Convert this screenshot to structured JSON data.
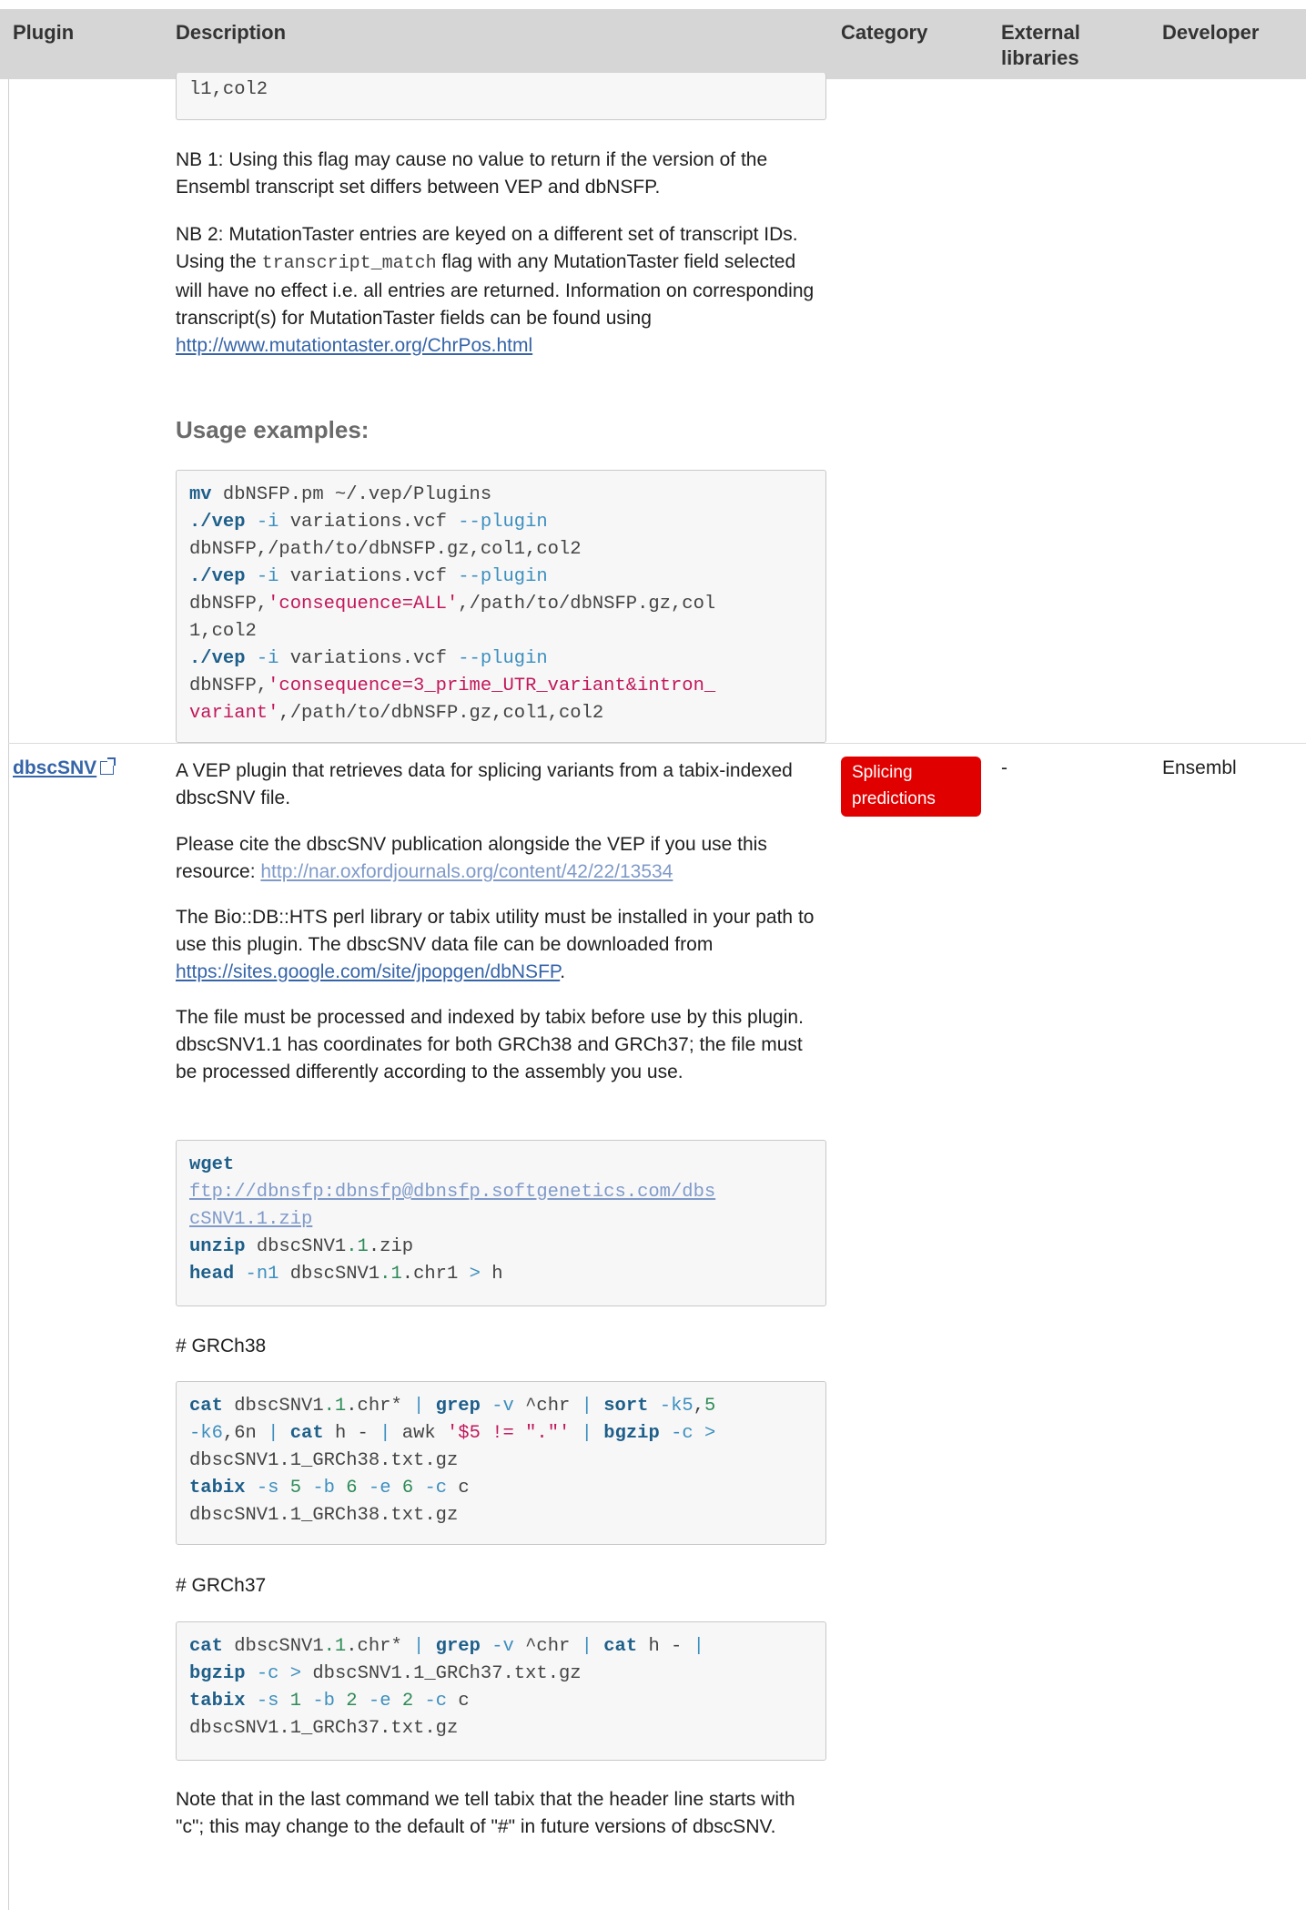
{
  "table_header": {
    "plugin": "Plugin",
    "description": "Description",
    "category": "Category",
    "external_libraries": "External libraries",
    "developer": "Developer"
  },
  "dbnsfp_section": {
    "code_tail": "l1,col2",
    "nb1": "NB 1: Using this flag may cause no value to return if the version of the Ensembl transcript set differs between VEP and dbNSFP.",
    "nb2_a": "NB 2: MutationTaster entries are keyed on a different set of transcript IDs. Using the ",
    "nb2_code": "transcript_match",
    "nb2_b": " flag with any MutationTaster field selected will have no effect i.e. all entries are returned. Information on corresponding transcript(s) for MutationTaster fields can be found using ",
    "nb2_link": "http://www.mutationtaster.org/ChrPos.html",
    "usage_heading": "Usage examples:",
    "usage_code": {
      "l1": [
        "mv",
        " dbNSFP.pm ~/.vep/Plugins"
      ],
      "l2": [
        "./vep",
        " -i",
        " variations.vcf",
        " --plugin"
      ],
      "l3": "dbNSFP,/path/to/dbNSFP.gz,col1,col2",
      "l4": [
        "./vep",
        " -i",
        " variations.vcf",
        " --plugin"
      ],
      "l5": [
        "dbNSFP,",
        "'consequence=ALL'",
        ",/path/to/dbNSFP.gz,col"
      ],
      "l6": "1,col2",
      "l7": [
        "./vep",
        " -i",
        " variations.vcf",
        " --plugin"
      ],
      "l8": [
        "dbNSFP,",
        "'consequence=3_prime_UTR_variant&intron_"
      ],
      "l9": [
        "variant'",
        ",/path/to/dbNSFP.gz,col1,col2"
      ]
    }
  },
  "dbscsnv_row": {
    "plugin_name": "dbscSNV",
    "category_badge": "Splicing predictions",
    "external_libraries": "-",
    "developer": "Ensembl",
    "desc1": "A VEP plugin that retrieves data for splicing variants from a tabix-indexed dbscSNV file.",
    "cite_text": "Please cite the dbscSNV publication alongside the VEP if you use this resource: ",
    "cite_link": "http://nar.oxfordjournals.org/content/42/22/13534",
    "lib_text": "The Bio::DB::HTS perl library or tabix utility must be installed in your path to use this plugin. The dbscSNV data file can be downloaded from ",
    "lib_link": "https://sites.google.com/site/jpopgen/dbNSFP",
    "lib_end": ".",
    "process_text": "The file must be processed and indexed by tabix before use by this plugin. dbscSNV1.1 has coordinates for both GRCh38 and GRCh37; the file must be processed differently according to the assembly you use.",
    "grch38_label": "# GRCh38",
    "grch37_label": "# GRCh37",
    "note_text": "Note that in the last command we tell tabix that the header line starts with \"c\"; this may change to the default of \"#\" in future versions of dbscSNV."
  }
}
